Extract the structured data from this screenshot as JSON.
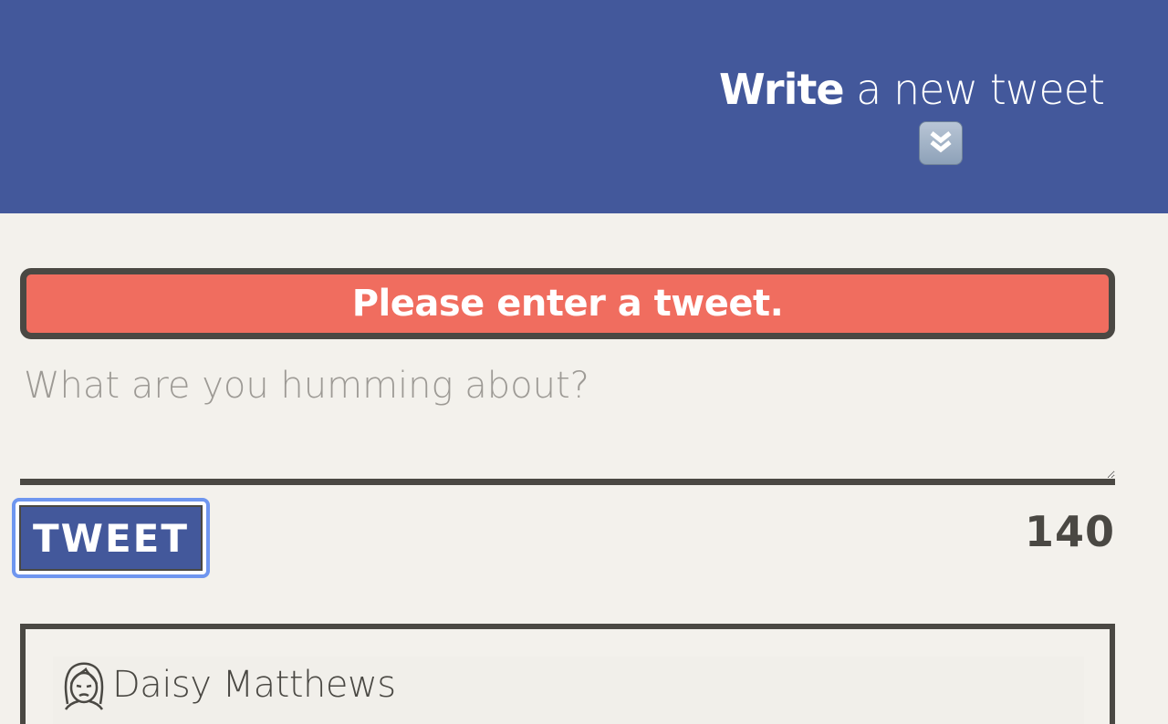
{
  "compose": {
    "title_strong": "Write",
    "title_rest": " a new tweet",
    "toggle_icon": "double-chevron-down-icon"
  },
  "error": {
    "message": "Please enter a tweet."
  },
  "tweet_form": {
    "placeholder": "What are you humming about?",
    "value": "",
    "submit_label": "TWEET",
    "char_count": "140"
  },
  "tweets": [
    {
      "author_name": "Daisy Matthews",
      "avatar_icon": "woman-face-icon"
    }
  ],
  "colors": {
    "header_bg": "#43589b",
    "page_bg": "#f3f1ec",
    "error_bg": "#f06d5f",
    "text_dark": "#4a4843",
    "focus_ring": "#6f96ef"
  }
}
